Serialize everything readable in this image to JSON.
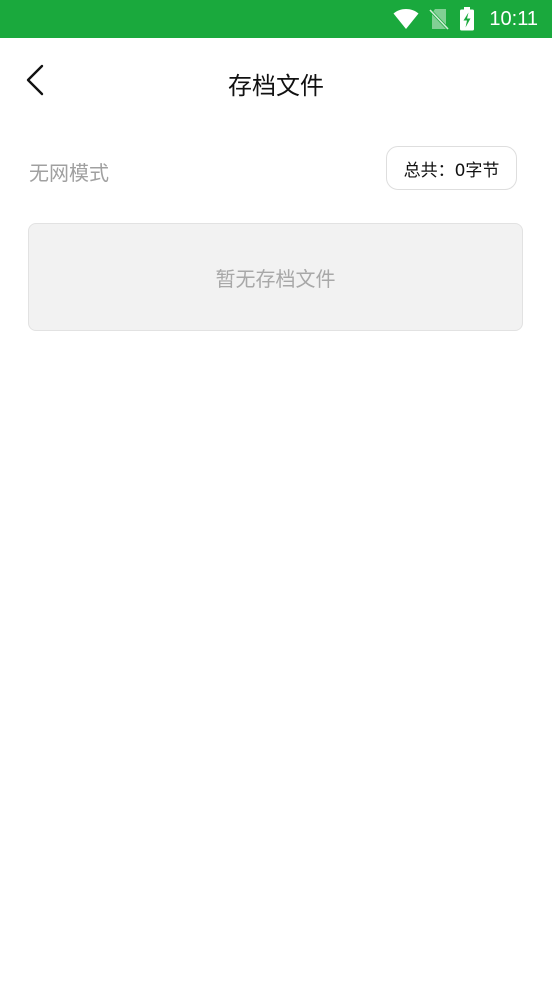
{
  "status_bar": {
    "time": "10:11",
    "bg_color": "#1aa93d",
    "icons": [
      "wifi-icon",
      "no-sim-icon",
      "battery-charging-icon"
    ]
  },
  "header": {
    "title": "存档文件",
    "back_icon": "chevron-left-icon"
  },
  "info": {
    "mode_label": "无网模式",
    "total_label": "总共：0字节"
  },
  "empty_state": {
    "message": "暂无存档文件"
  }
}
